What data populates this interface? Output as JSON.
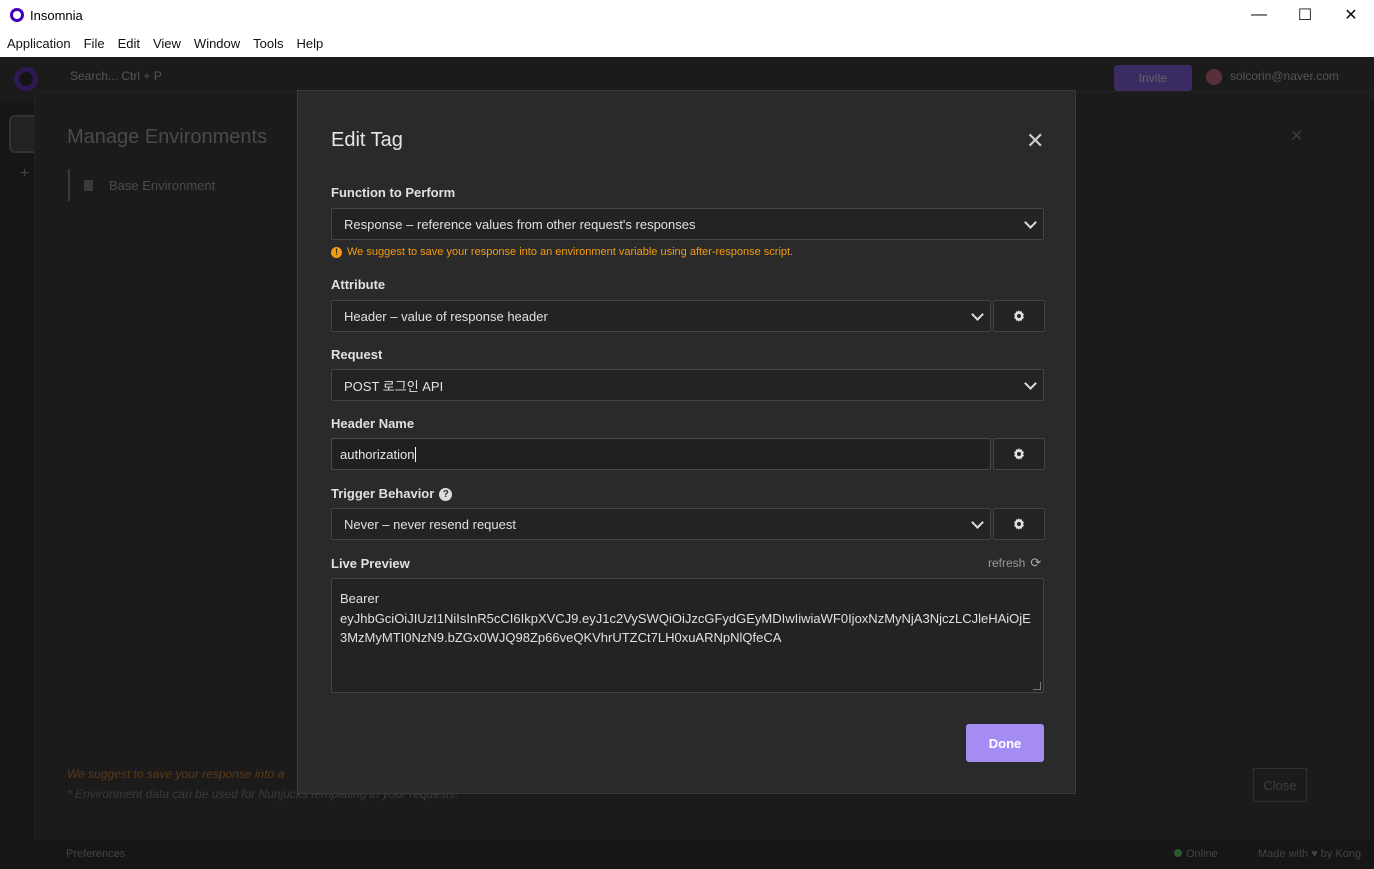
{
  "window": {
    "title": "Insomnia",
    "controls": {
      "minimize": "—",
      "maximize": "☐",
      "close": "✕"
    }
  },
  "menu": [
    "Application",
    "File",
    "Edit",
    "View",
    "Window",
    "Tools",
    "Help"
  ],
  "background": {
    "search_placeholder": "Search...   Ctrl + P",
    "invite_label": "Invite",
    "user_email": "solcorin@naver.com",
    "manage_title": "Manage Environments",
    "base_environment": "Base Environment",
    "warning_text": "We suggest to save your response into a",
    "note_text": "* Environment data can be used for Nunjucks templating in your requests.",
    "close_label": "Close",
    "preferences_label": "Preferences",
    "online_label": "Online",
    "made_by_label": "Made with ♥ by Kong"
  },
  "modal": {
    "title": "Edit Tag",
    "close_glyph": "✕",
    "function_label": "Function to Perform",
    "function_value": "Response – reference values from other request's responses",
    "hint_text": "We suggest to save your response into an environment variable using after-response script.",
    "attribute_label": "Attribute",
    "attribute_value": "Header – value of response header",
    "request_label": "Request",
    "request_value": "POST 로그인 API",
    "header_name_label": "Header Name",
    "header_name_value": "authorization",
    "trigger_label": "Trigger Behavior",
    "trigger_value": "Never – never resend request",
    "preview_label": "Live Preview",
    "refresh_label": "refresh",
    "preview_value": "Bearer\neyJhbGciOiJIUzI1NiIsInR5cCI6IkpXVCJ9.eyJ1c2VySWQiOiJzcGFydGEyMDIwIiwiaWF0IjoxNzMyNjA3NjczLCJleHAiOjE3MzMyMTI0NzN9.bZGx0WJQ98Zp66veQKVhrUTZCt7LH0xuARNpNlQfeCA",
    "done_label": "Done"
  },
  "colors": {
    "accent": "#a58cf5",
    "warning": "#f39c12",
    "modal_bg": "#2a2a2a"
  },
  "icons": [
    "insomnia-logo-icon",
    "close-icon",
    "chevron-down-icon",
    "gear-icon",
    "help-icon",
    "refresh-icon",
    "warning-icon"
  ]
}
